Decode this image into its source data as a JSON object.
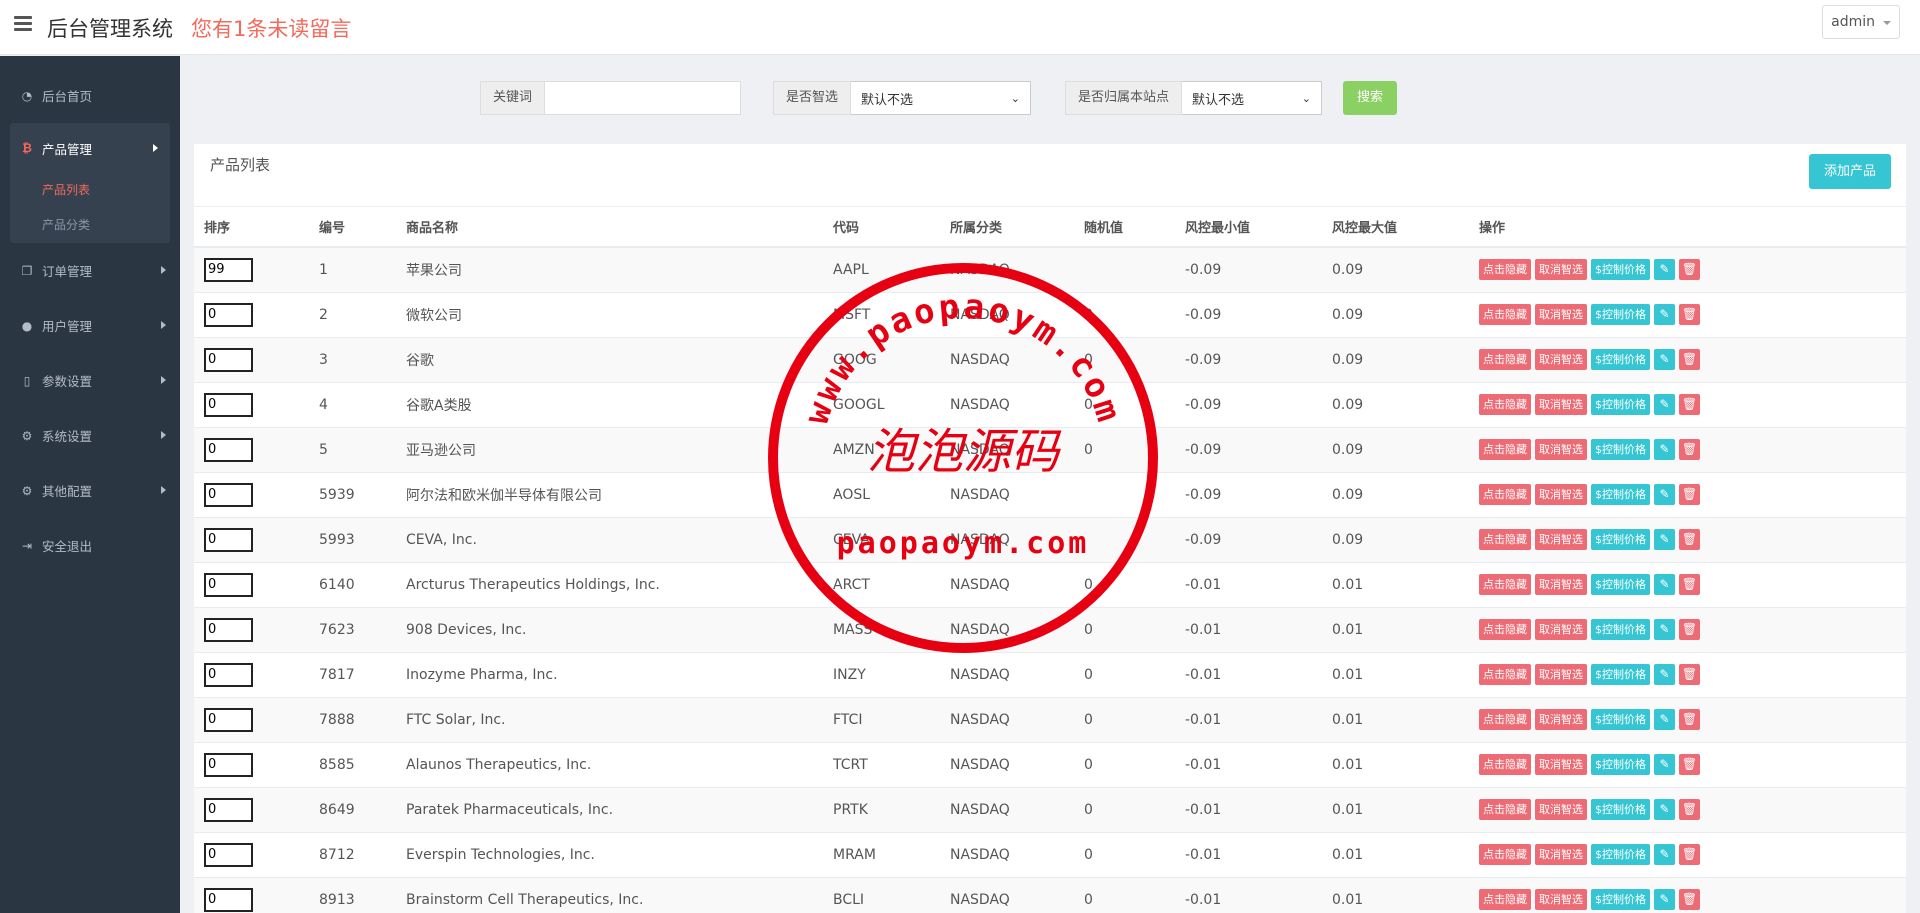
{
  "header": {
    "title": "后台管理系统",
    "notice": "您有1条未读留言",
    "user": "admin"
  },
  "sidebar": {
    "home": "后台首页",
    "product": "产品管理",
    "product_sub": [
      "产品列表",
      "产品分类"
    ],
    "orders": "订单管理",
    "users": "用户管理",
    "params": "参数设置",
    "system": "系统设置",
    "other": "其他配置",
    "logout": "安全退出"
  },
  "search": {
    "keyword_label": "关键词",
    "keyword_value": "",
    "smart_label": "是否智选",
    "smart_value": "默认不选",
    "site_label": "是否归属本站点",
    "site_value": "默认不选",
    "button": "搜索"
  },
  "panel": {
    "title": "产品列表",
    "add_button": "添加产品"
  },
  "table": {
    "headers": [
      "排序",
      "编号",
      "商品名称",
      "代码",
      "所属分类",
      "随机值",
      "风控最小值",
      "风控最大值",
      "操作"
    ],
    "actions": [
      "点击隐藏",
      "取消智选",
      "$控制价格"
    ],
    "rows": [
      {
        "sort": "99",
        "id": "1",
        "name": "苹果公司",
        "code": "AAPL",
        "cat": "NASDAQ",
        "rand": "",
        "min": "-0.09",
        "max": "0.09"
      },
      {
        "sort": "0",
        "id": "2",
        "name": "微软公司",
        "code": "MSFT",
        "cat": "NASDAQ",
        "rand": "0",
        "min": "-0.09",
        "max": "0.09"
      },
      {
        "sort": "0",
        "id": "3",
        "name": "谷歌",
        "code": "GOOG",
        "cat": "NASDAQ",
        "rand": "0",
        "min": "-0.09",
        "max": "0.09"
      },
      {
        "sort": "0",
        "id": "4",
        "name": "谷歌A类股",
        "code": "GOOGL",
        "cat": "NASDAQ",
        "rand": "0",
        "min": "-0.09",
        "max": "0.09"
      },
      {
        "sort": "0",
        "id": "5",
        "name": "亚马逊公司",
        "code": "AMZN",
        "cat": "NASDAQ",
        "rand": "0",
        "min": "-0.09",
        "max": "0.09"
      },
      {
        "sort": "0",
        "id": "5939",
        "name": "阿尔法和欧米伽半导体有限公司",
        "code": "AOSL",
        "cat": "NASDAQ",
        "rand": "",
        "min": "-0.09",
        "max": "0.09"
      },
      {
        "sort": "0",
        "id": "5993",
        "name": "CEVA, Inc.",
        "code": "CEVA",
        "cat": "NASDAQ",
        "rand": "",
        "min": "-0.09",
        "max": "0.09"
      },
      {
        "sort": "0",
        "id": "6140",
        "name": "Arcturus Therapeutics Holdings, Inc.",
        "code": "ARCT",
        "cat": "NASDAQ",
        "rand": "0",
        "min": "-0.01",
        "max": "0.01"
      },
      {
        "sort": "0",
        "id": "7623",
        "name": "908 Devices, Inc.",
        "code": "MASS",
        "cat": "NASDAQ",
        "rand": "0",
        "min": "-0.01",
        "max": "0.01"
      },
      {
        "sort": "0",
        "id": "7817",
        "name": "Inozyme Pharma, Inc.",
        "code": "INZY",
        "cat": "NASDAQ",
        "rand": "0",
        "min": "-0.01",
        "max": "0.01"
      },
      {
        "sort": "0",
        "id": "7888",
        "name": "FTC Solar, Inc.",
        "code": "FTCI",
        "cat": "NASDAQ",
        "rand": "0",
        "min": "-0.01",
        "max": "0.01"
      },
      {
        "sort": "0",
        "id": "8585",
        "name": "Alaunos Therapeutics, Inc.",
        "code": "TCRT",
        "cat": "NASDAQ",
        "rand": "0",
        "min": "-0.01",
        "max": "0.01"
      },
      {
        "sort": "0",
        "id": "8649",
        "name": "Paratek Pharmaceuticals, Inc.",
        "code": "PRTK",
        "cat": "NASDAQ",
        "rand": "0",
        "min": "-0.01",
        "max": "0.01"
      },
      {
        "sort": "0",
        "id": "8712",
        "name": "Everspin Technologies, Inc.",
        "code": "MRAM",
        "cat": "NASDAQ",
        "rand": "0",
        "min": "-0.01",
        "max": "0.01"
      },
      {
        "sort": "0",
        "id": "8913",
        "name": "Brainstorm Cell Therapeutics, Inc.",
        "code": "BCLI",
        "cat": "NASDAQ",
        "rand": "0",
        "min": "-0.01",
        "max": "0.01"
      }
    ]
  },
  "watermark": {
    "url_arc": "www.paopaoym.com",
    "brand": "泡泡源码",
    "url_line": "paopaoym.com"
  },
  "colors": {
    "sidebar": "#2b3643",
    "accent": "#f36a5a",
    "button_red": "#ed6b75",
    "button_teal": "#36c6d3",
    "search_green": "#8bd063",
    "stamp_red": "#e60012"
  }
}
